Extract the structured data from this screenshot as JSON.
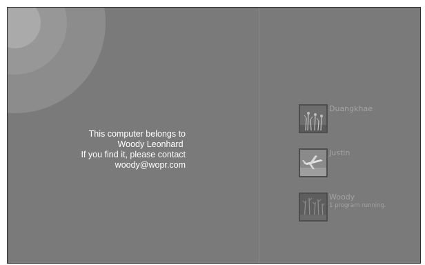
{
  "owner_message": {
    "line1": "This computer belongs to",
    "line2": "Woody Leonhard ",
    "line3": "If you find it, please contact",
    "line4": "woody@wopr.com"
  },
  "users": [
    {
      "name": "Duangkhae",
      "status": "",
      "picture_icon": "plants-icon"
    },
    {
      "name": "Justin",
      "status": "",
      "picture_icon": "airplane-icon"
    },
    {
      "name": "Woody",
      "status": "1 program running.",
      "picture_icon": "trees-icon"
    }
  ],
  "colors": {
    "background": "#7a7a7a",
    "text": "#ffffff",
    "user_label": "#a4a4a4"
  }
}
